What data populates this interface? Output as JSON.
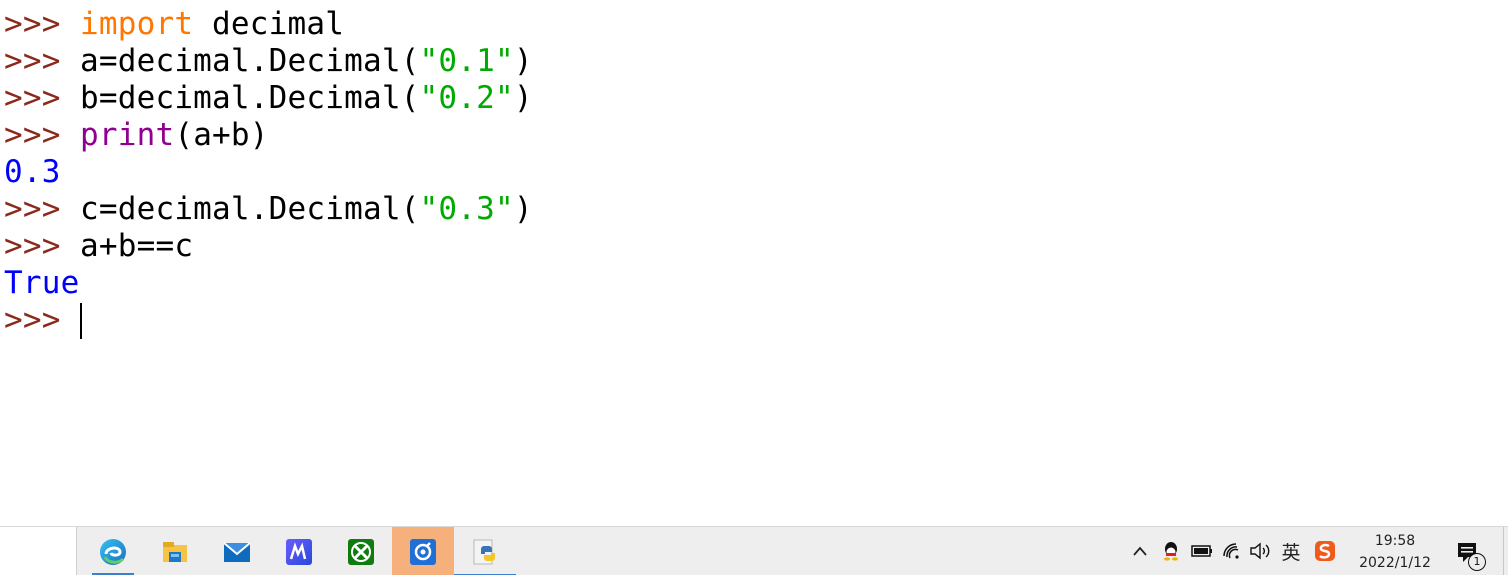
{
  "shell": {
    "prompt": ">>> ",
    "lines": [
      {
        "kind": "input",
        "parts": [
          {
            "cls": "kw",
            "text": "import"
          },
          {
            "cls": "",
            "text": " decimal"
          }
        ]
      },
      {
        "kind": "input",
        "parts": [
          {
            "cls": "",
            "text": "a=decimal.Decimal("
          },
          {
            "cls": "str",
            "text": "\"0.1\""
          },
          {
            "cls": "",
            "text": ")"
          }
        ]
      },
      {
        "kind": "input",
        "parts": [
          {
            "cls": "",
            "text": "b=decimal.Decimal("
          },
          {
            "cls": "str",
            "text": "\"0.2\""
          },
          {
            "cls": "",
            "text": ")"
          }
        ]
      },
      {
        "kind": "input",
        "parts": [
          {
            "cls": "builtin",
            "text": "print"
          },
          {
            "cls": "",
            "text": "(a+b)"
          }
        ]
      },
      {
        "kind": "output",
        "text": "0.3"
      },
      {
        "kind": "input",
        "parts": [
          {
            "cls": "",
            "text": "c=decimal.Decimal("
          },
          {
            "cls": "str",
            "text": "\"0.3\""
          },
          {
            "cls": "",
            "text": ")"
          }
        ]
      },
      {
        "kind": "input",
        "parts": [
          {
            "cls": "",
            "text": "a+b==c"
          }
        ]
      },
      {
        "kind": "output",
        "text": "True"
      },
      {
        "kind": "current",
        "parts": []
      }
    ]
  },
  "taskbar": {
    "apps": [
      {
        "name": "edge-icon",
        "state": "active"
      },
      {
        "name": "file-explorer-icon",
        "state": ""
      },
      {
        "name": "mail-icon",
        "state": ""
      },
      {
        "name": "app-m-icon",
        "state": ""
      },
      {
        "name": "xbox-icon",
        "state": ""
      },
      {
        "name": "music-player-icon",
        "state": "highlight"
      },
      {
        "name": "python-idle-icon",
        "state": "running"
      }
    ],
    "tray": {
      "chevron": "^",
      "ime_label": "英",
      "time": "19:58",
      "date": "2022/1/12",
      "notification_count": "1"
    }
  },
  "colors": {
    "prompt": "#8b2a1c",
    "keyword": "#ff7700",
    "string": "#00aa00",
    "builtin": "#900090",
    "output": "#0000ff"
  }
}
